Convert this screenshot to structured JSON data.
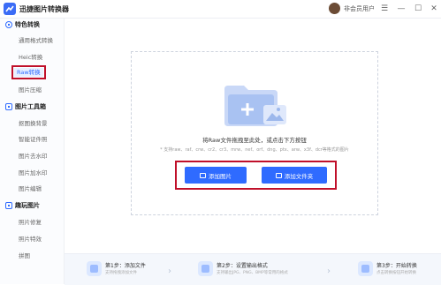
{
  "app": {
    "title": "迅捷图片转换器"
  },
  "user": {
    "name": "非会员用户"
  },
  "window_controls": {
    "menu": "☰",
    "minimize": "—",
    "maximize": "☐",
    "close": "✕"
  },
  "sidebar": {
    "sections": [
      {
        "title": "特色转换",
        "icon": "star-circle-icon",
        "items": [
          "通用格式转换",
          "Heic转换",
          "Raw转换",
          "图片压缩"
        ]
      },
      {
        "title": "图片工具箱",
        "icon": "toolbox-icon",
        "items": [
          "抠图换背景",
          "智能证件照",
          "图片去水印",
          "图片加水印",
          "图片编辑"
        ]
      },
      {
        "title": "趣玩图片",
        "icon": "fun-icon",
        "items": [
          "照片修复",
          "照片特效",
          "拼图"
        ]
      }
    ],
    "active_item": "Raw转换"
  },
  "dropzone": {
    "title": "将Raw文件拖拽至此处，或点击下方按钮",
    "hint": "* 支持raw、raf、crw、cr2、cr3、mrw、nef、orf、dng、ptx、arw、x3f、dcr等格式的图片",
    "add_image_label": "添加图片",
    "add_folder_label": "添加文件夹"
  },
  "steps": [
    {
      "title": "第1步：添加文件",
      "desc": "支持拖拽添加文件"
    },
    {
      "title": "第2步：设置输出格式",
      "desc": "支持输出JPG、PNG、BMP等常用的格式"
    },
    {
      "title": "第3步：开始转换",
      "desc": "点击转换按钮开始转换"
    }
  ],
  "colors": {
    "accent": "#2f6bff",
    "highlight": "#c0102a"
  }
}
